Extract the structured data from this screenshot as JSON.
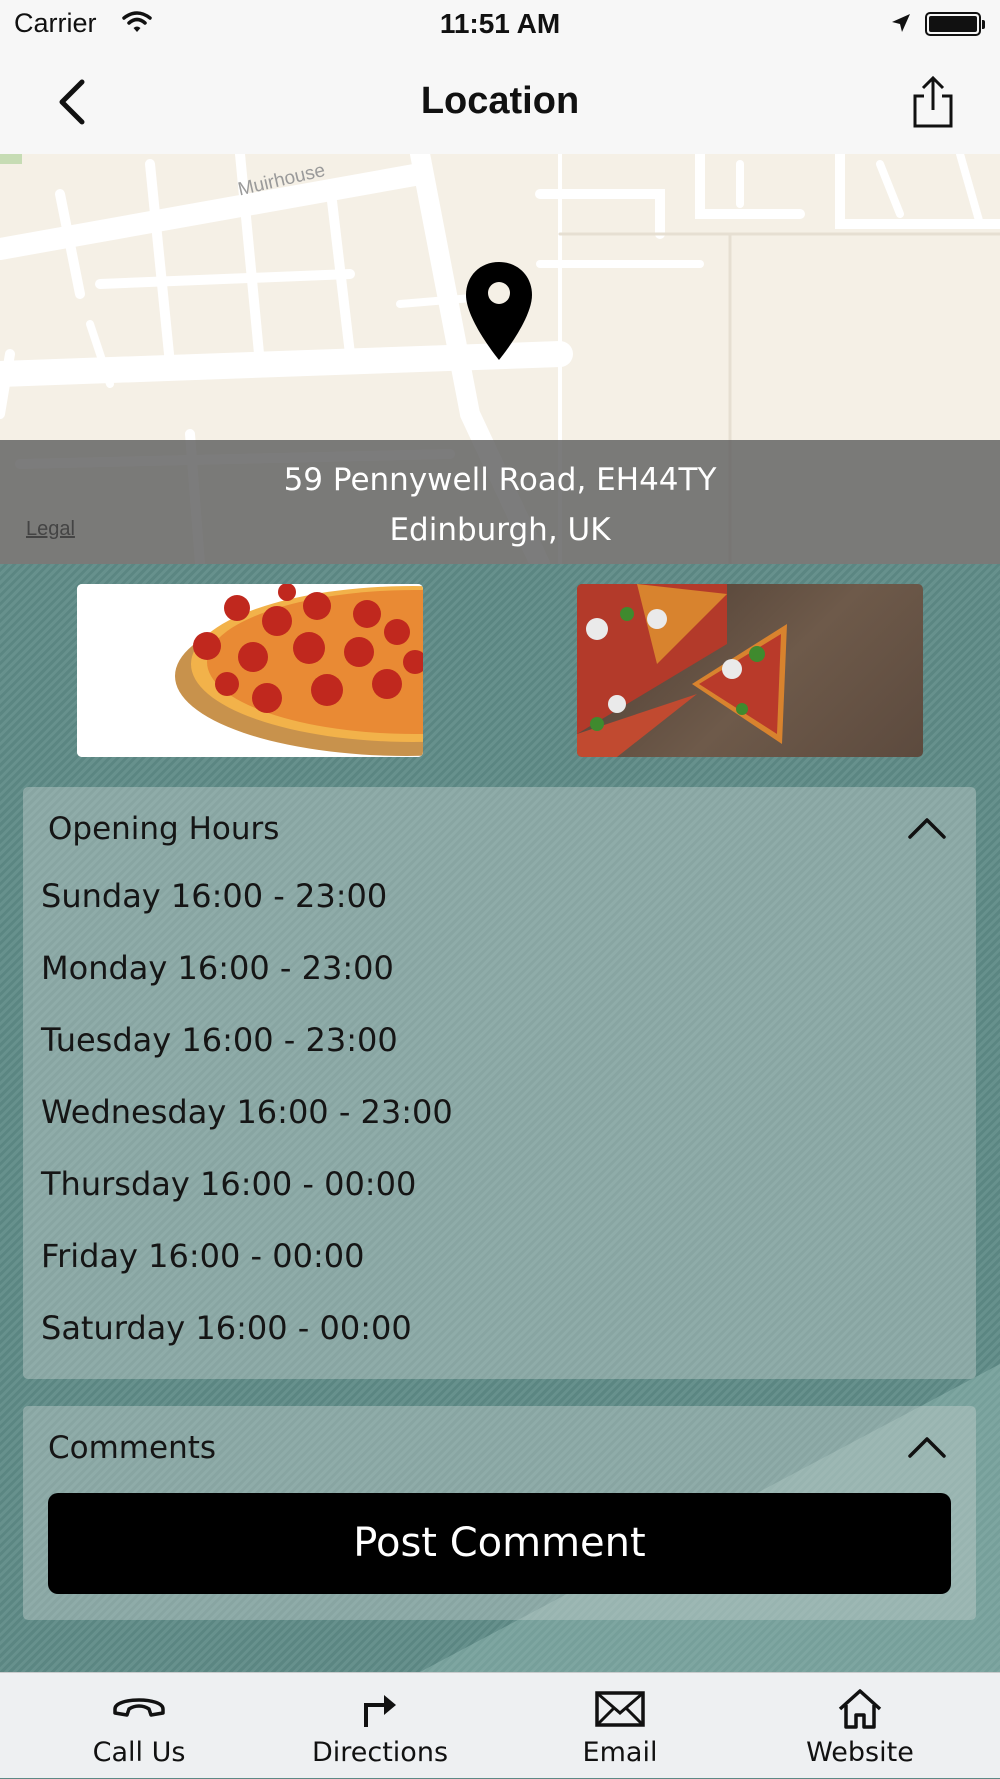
{
  "status_bar": {
    "carrier": "Carrier",
    "time": "11:51 AM"
  },
  "nav": {
    "title": "Location",
    "back_icon": "chevron-left-icon",
    "share_icon": "share-icon"
  },
  "map": {
    "street_label": "Muirhouse",
    "address_line1": "59 Pennywell Road, EH44TY",
    "address_line2": "Edinburgh, UK",
    "legal_link": "Legal"
  },
  "images": [
    {
      "name": "pepperoni-pizza-image"
    },
    {
      "name": "pizza-slices-image"
    }
  ],
  "opening_hours": {
    "title": "Opening Hours",
    "rows": [
      "Sunday 16:00 - 23:00",
      "Monday 16:00 - 23:00",
      "Tuesday 16:00 - 23:00",
      "Wednesday 16:00 - 23:00",
      "Thursday 16:00 - 00:00",
      "Friday 16:00 - 00:00",
      "Saturday 16:00 - 00:00"
    ]
  },
  "comments": {
    "title": "Comments",
    "post_button": "Post Comment"
  },
  "tab_bar": {
    "items": [
      {
        "label": "Call Us",
        "icon": "phone-icon"
      },
      {
        "label": "Directions",
        "icon": "directions-icon"
      },
      {
        "label": "Email",
        "icon": "email-icon"
      },
      {
        "label": "Website",
        "icon": "home-icon"
      }
    ]
  },
  "colors": {
    "content_background": "#5e8a86",
    "button_background": "#000000",
    "bar_background": "#f7f7f7"
  }
}
